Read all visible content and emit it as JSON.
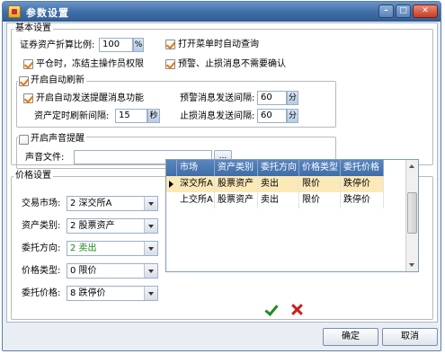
{
  "window": {
    "title": "参数设置"
  },
  "basic": {
    "group_title": "基本设置",
    "ratio_label": "证券资产折算比例:",
    "ratio_value": "100",
    "ratio_unit": "%",
    "open_menu_query": "打开菜单时自动查询",
    "close_position_freeze": "平仓时，冻结主操作员权限",
    "warn_stop_no_confirm": "预警、止损消息不需要确认",
    "auto_refresh_group": "开启自动刷新",
    "auto_send_alert": "开启自动发送提醒消息功能",
    "alert_interval_label": "预警消息发送间隔:",
    "alert_interval_value": "60",
    "alert_interval_unit": "分",
    "asset_refresh_label": "资产定时刷新间隔:",
    "asset_refresh_value": "15",
    "asset_refresh_unit": "秒",
    "stop_interval_label": "止损消息发送间隔:",
    "stop_interval_value": "60",
    "stop_interval_unit": "分",
    "sound_group": "开启声音提醒",
    "sound_file_label": "声音文件:",
    "sound_file_value": "",
    "browse_label": "..."
  },
  "price": {
    "group_title": "价格设置",
    "market_label": "交易市场:",
    "market_value": "2  深交所A",
    "asset_type_label": "资产类别:",
    "asset_type_value": "2  股票资产",
    "direction_label": "委托方向:",
    "direction_value": "2  卖出",
    "price_type_label": "价格类型:",
    "price_type_value": "0  限价",
    "order_price_label": "委托价格:",
    "order_price_value": "8  跌停价",
    "table": {
      "headers": [
        "市场",
        "资产类别",
        "委托方向",
        "价格类型",
        "委托价格"
      ],
      "rows": [
        [
          "深交所A",
          "股票资产",
          "卖出",
          "限价",
          "跌停价"
        ],
        [
          "上交所A",
          "股票资产",
          "卖出",
          "限价",
          "跌停价"
        ]
      ]
    }
  },
  "buttons": {
    "confirm": "确定",
    "cancel": "取消"
  },
  "colors": {
    "title_bar": "#3f6da6",
    "selected_row": "#fbe9b8",
    "check_mark": "#e07a10"
  },
  "icons": {
    "titlebar": [
      "app-icon",
      "minimize-icon",
      "maximize-icon",
      "close-icon"
    ],
    "actions": [
      "check-icon",
      "delete-icon"
    ]
  }
}
